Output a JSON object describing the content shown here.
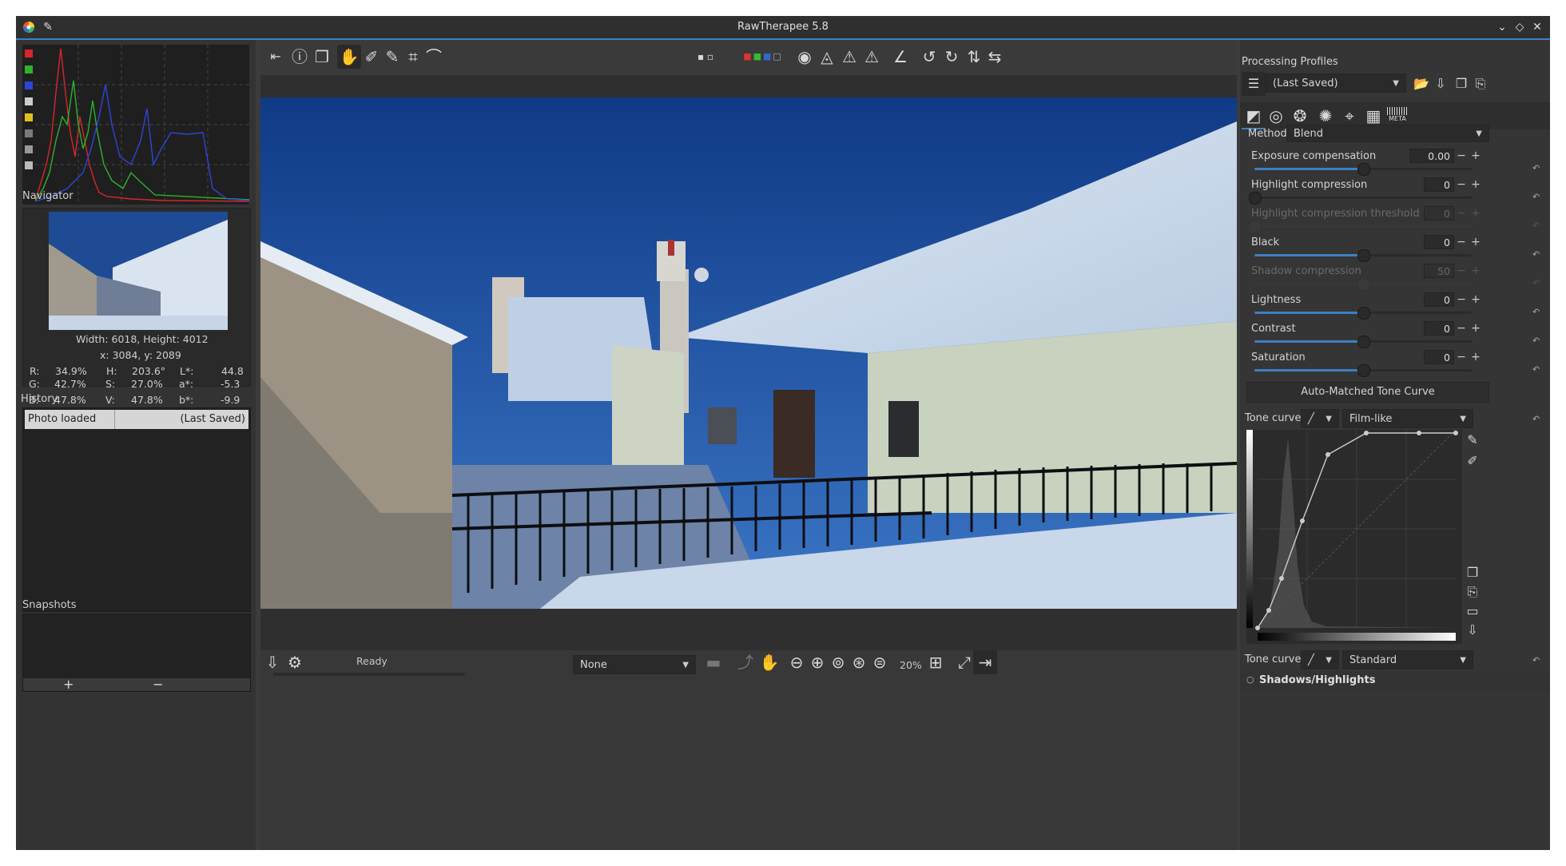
{
  "window": {
    "title": "RawTherapee 5.8"
  },
  "histogram": {
    "swatch_colors": [
      "#d8262b",
      "#2bb32b",
      "#2d46d6",
      "#cccccc",
      "#e0c020",
      "#7a7a7a",
      "#999999",
      "#bbbbbb"
    ]
  },
  "navigator": {
    "label": "Navigator",
    "size_text": "Width: 6018, Height: 4012",
    "pos_text": "x: 3084, y: 2089",
    "rows": [
      {
        "c1": "R:",
        "v1": "34.9%",
        "c2": "H:",
        "v2": "203.6°",
        "c3": "L*:",
        "v3": "44.8"
      },
      {
        "c1": "G:",
        "v1": "42.7%",
        "c2": "S:",
        "v2": "27.0%",
        "c3": "a*:",
        "v3": "-5.3"
      },
      {
        "c1": "B:",
        "v1": "47.8%",
        "c2": "V:",
        "v2": "47.8%",
        "c3": "b*:",
        "v3": "-9.9"
      }
    ]
  },
  "history": {
    "label": "History",
    "rows": [
      {
        "action": "Photo loaded",
        "profile": "(Last Saved)"
      }
    ]
  },
  "snapshots": {
    "label": "Snapshots",
    "add": "+",
    "remove": "−"
  },
  "statusbar": {
    "status": "Ready",
    "preview_mode": "None",
    "zoom": "20%"
  },
  "right": {
    "profiles_label": "Processing Profiles",
    "profile_value": "(Last Saved)",
    "method_label": "Method:",
    "method_value": "Blend",
    "sliders": [
      {
        "label": "Exposure compensation",
        "value": "0.00",
        "pos": 0.5,
        "enabled": true,
        "filled": true
      },
      {
        "label": "Highlight compression",
        "value": "0",
        "pos": 0.0,
        "enabled": true,
        "filled": false
      },
      {
        "label": "Highlight compression threshold",
        "value": "0",
        "pos": 0.0,
        "enabled": false,
        "filled": false
      },
      {
        "label": "Black",
        "value": "0",
        "pos": 0.5,
        "enabled": true,
        "filled": true
      },
      {
        "label": "Shadow compression",
        "value": "50",
        "pos": 0.5,
        "enabled": false,
        "filled": false
      },
      {
        "label": "Lightness",
        "value": "0",
        "pos": 0.5,
        "enabled": true,
        "filled": true
      },
      {
        "label": "Contrast",
        "value": "0",
        "pos": 0.5,
        "enabled": true,
        "filled": true
      },
      {
        "label": "Saturation",
        "value": "0",
        "pos": 0.5,
        "enabled": true,
        "filled": true
      }
    ],
    "auto_tone_label": "Auto-Matched Tone Curve",
    "curve1_label": "Tone curve 1:",
    "curve1_mode": "Film-like",
    "curve2_label": "Tone curve 2:",
    "curve2_mode": "Standard",
    "section_label": "Shadows/Highlights",
    "tab_meta": "META"
  }
}
